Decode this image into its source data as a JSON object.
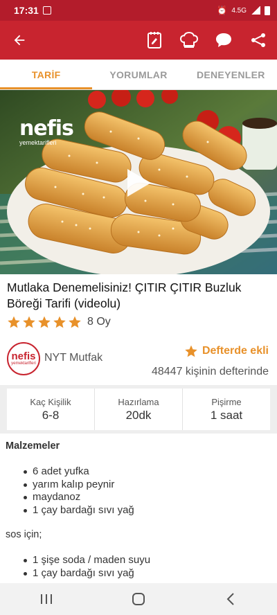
{
  "status_bar": {
    "time": "17:31",
    "network": "4.5G",
    "icons": [
      "image-icon",
      "alarm-icon",
      "signal-icon",
      "battery-icon"
    ]
  },
  "app_bar": {
    "icons": [
      "back-arrow-icon",
      "notebook-icon",
      "chef-hat-icon",
      "chat-bubble-icon",
      "share-icon"
    ],
    "color": "#c8242f"
  },
  "tabs": [
    {
      "label": "TARİF",
      "active": true
    },
    {
      "label": "YORUMLAR",
      "active": false
    },
    {
      "label": "DENEYENLER",
      "active": false
    }
  ],
  "hero": {
    "watermark_big": "nefis",
    "watermark_small": "yemektarifleri"
  },
  "recipe": {
    "title": "Mutlaka Denemelisiniz! ÇITIR ÇITIR Buzluk Böreği Tarifi (videolu)",
    "stars": 5,
    "vote_count": "8 Oy"
  },
  "author": {
    "avatar_big": "nefis",
    "avatar_small": "yemektarifleri",
    "name": "NYT Mutfak",
    "favorite_label": "Defterde ekli",
    "favorite_count": "48447 kişinin defterinde"
  },
  "stats": [
    {
      "label": "Kaç Kişilik",
      "value": "6-8"
    },
    {
      "label": "Hazırlama",
      "value": "20dk"
    },
    {
      "label": "Pişirme",
      "value": "1 saat"
    }
  ],
  "ingredients": {
    "title": "Malzemeler",
    "main_items": [
      "6 adet yufka",
      "yarım kalıp peynir",
      "maydanoz",
      "1 çay bardağı sıvı yağ"
    ],
    "sauce_title": "sos için;",
    "sauce_items": [
      "1 şişe soda / maden suyu",
      "1 çay bardağı sıvı yağ"
    ]
  },
  "colors": {
    "accent": "#e8912a",
    "brand": "#c8242f"
  }
}
